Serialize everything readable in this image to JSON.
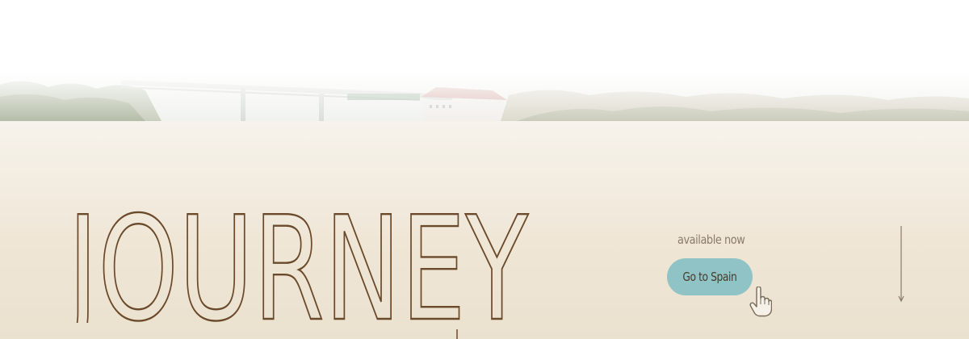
{
  "hero": {
    "image": "river-bridge-landscape-photo"
  },
  "main": {
    "title": "JOURNEY",
    "availability_text": "available now",
    "cta_label": "Go to Spain"
  },
  "icons": {
    "cursor": "hand-pointer-icon",
    "scroll": "scroll-down-arrow-icon"
  },
  "colors": {
    "panel_background": "#efe6d6",
    "title_outline": "#6b4a2b",
    "cta_background": "#8fc3c6",
    "cta_text": "#4a3a2a",
    "muted_text": "#8a7b6a"
  }
}
